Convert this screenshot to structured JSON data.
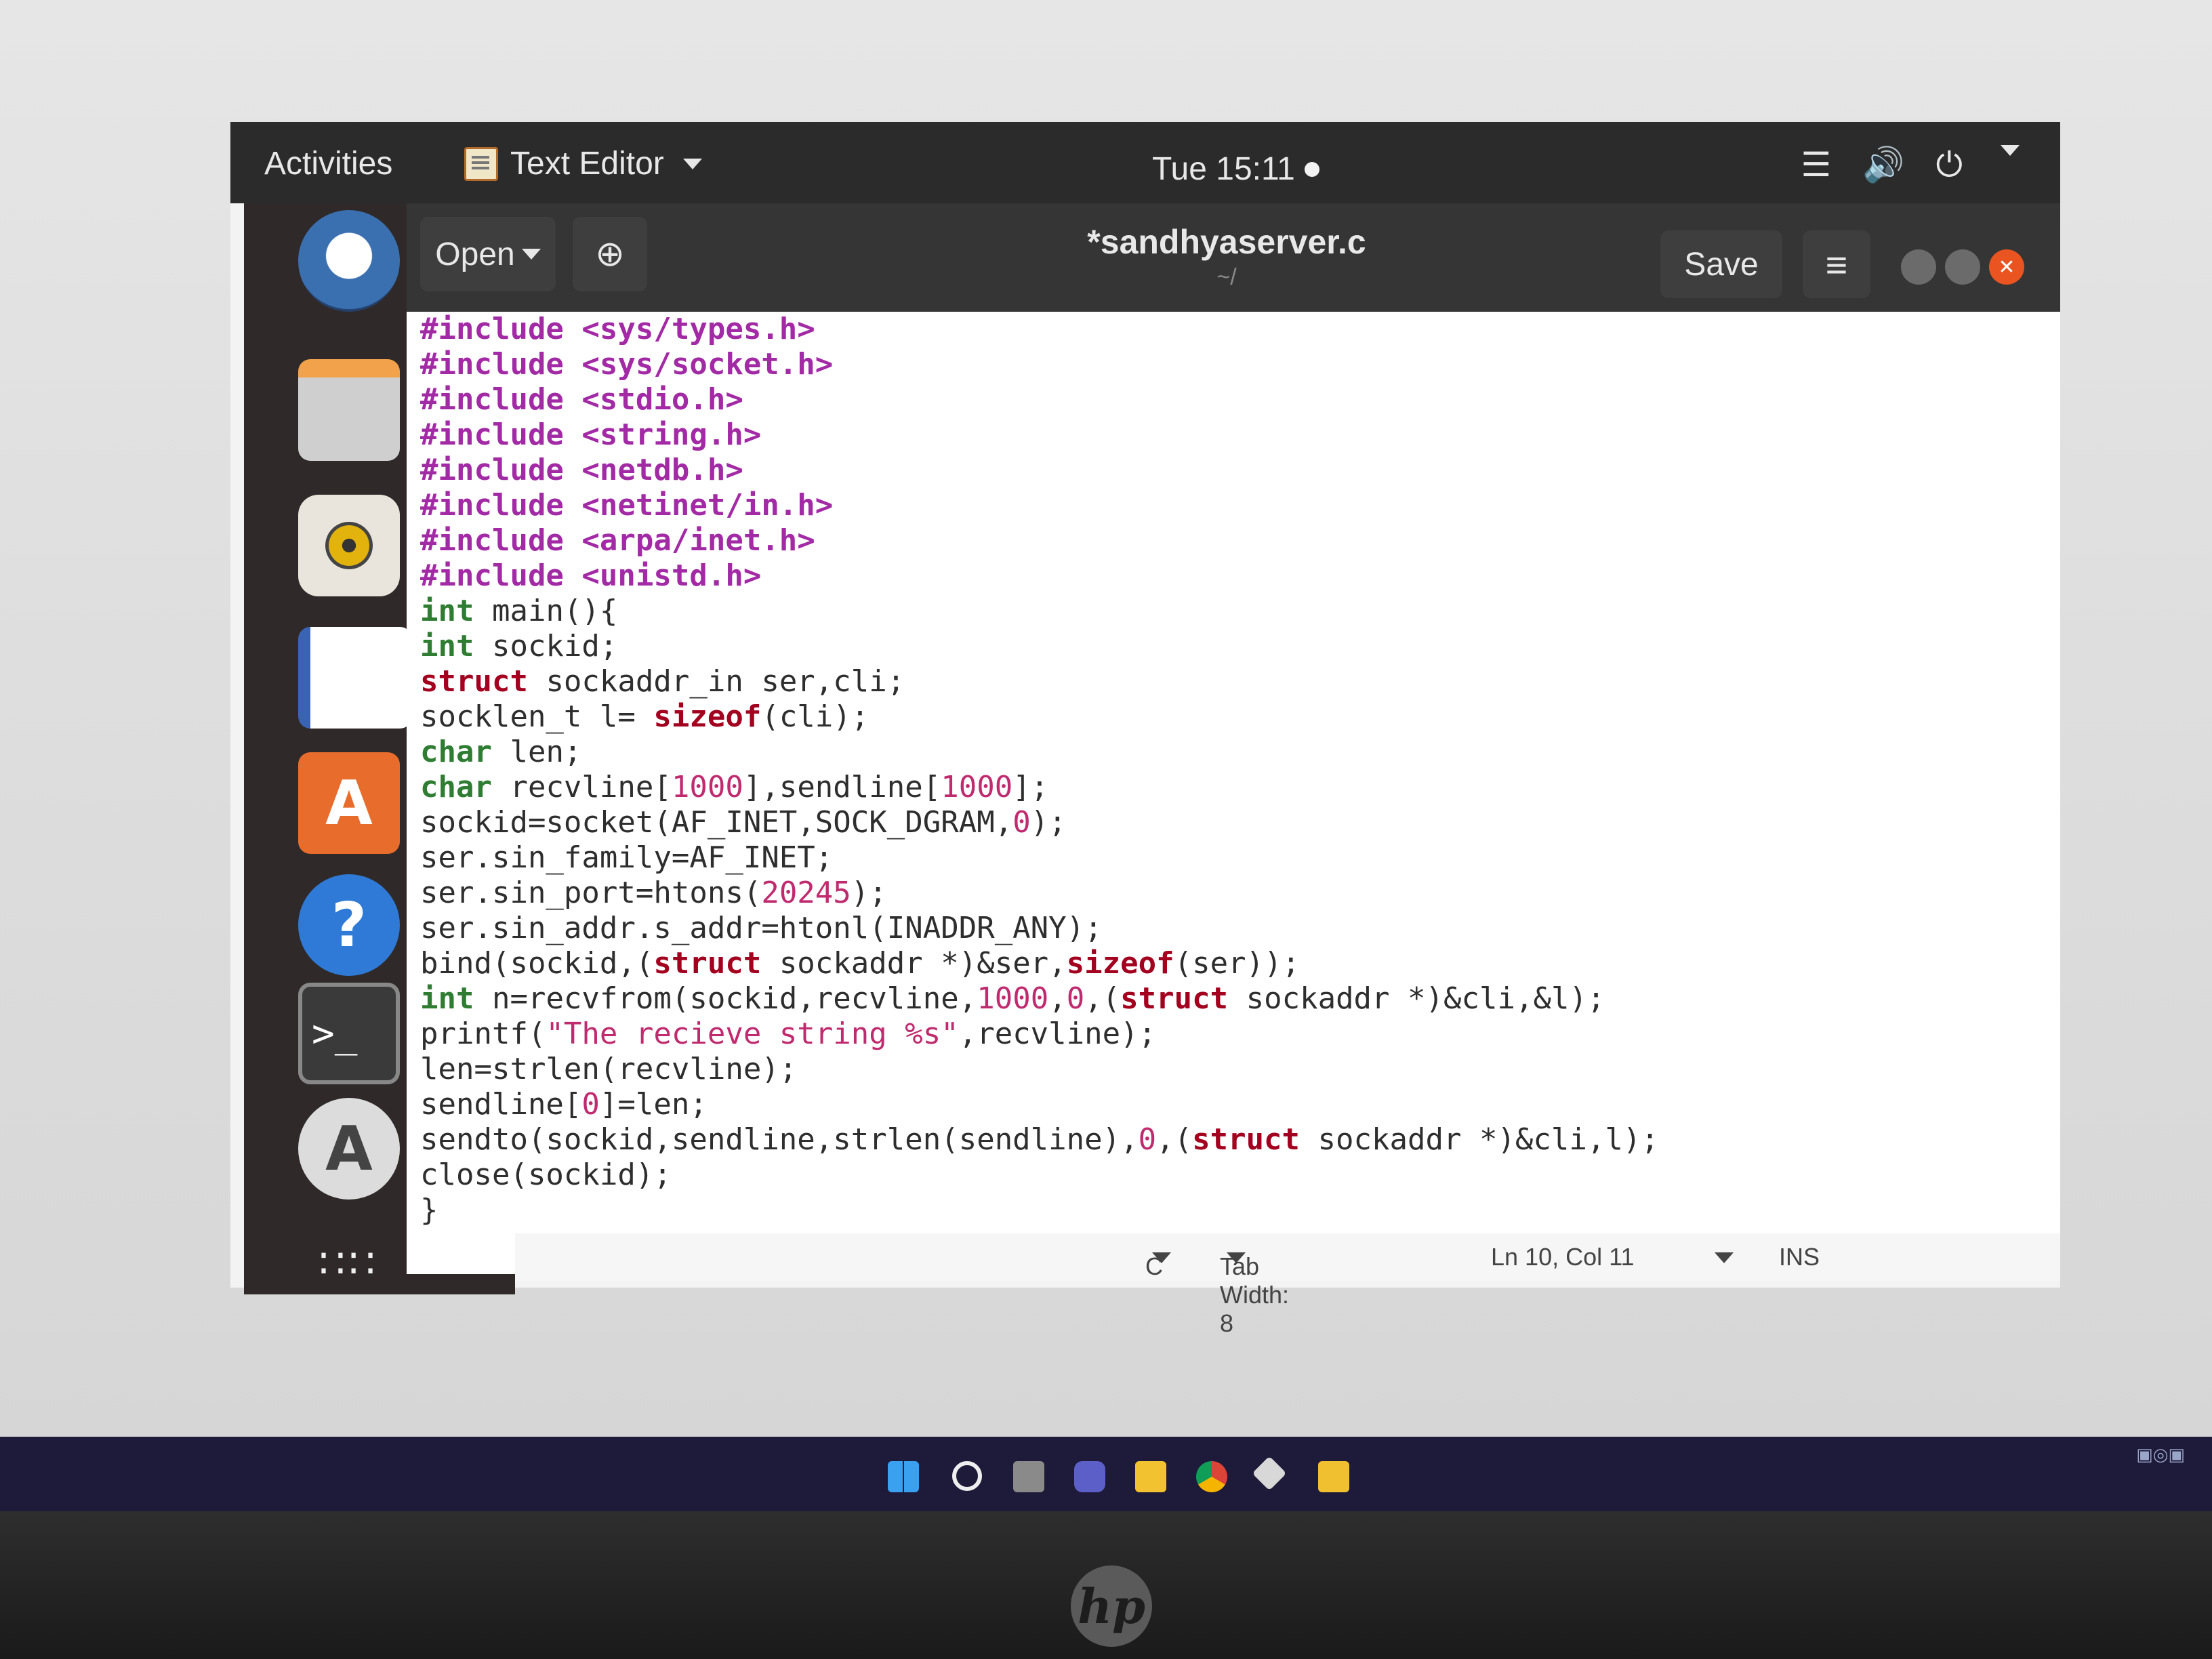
{
  "topbar": {
    "activities": "Activities",
    "app_name": "Text Editor",
    "clock": "Tue 15:11"
  },
  "headerbar": {
    "open_label": "Open",
    "title": "*sandhyaserver.c",
    "subtitle": "~/",
    "save_label": "Save"
  },
  "code": {
    "lines": [
      [
        [
          "pre",
          "#include <sys/types.h>"
        ]
      ],
      [
        [
          "pre",
          "#include <sys/socket.h>"
        ]
      ],
      [
        [
          "pre",
          "#include <stdio.h>"
        ]
      ],
      [
        [
          "pre",
          "#include <string.h>"
        ]
      ],
      [
        [
          "pre",
          "#include <netdb.h>"
        ]
      ],
      [
        [
          "pre",
          "#include <netinet/in.h>"
        ]
      ],
      [
        [
          "pre",
          "#include <arpa/inet.h>"
        ]
      ],
      [
        [
          "pre",
          "#include <unistd.h>"
        ]
      ],
      [
        [
          "kw",
          "int"
        ],
        [
          "plain",
          " main(){"
        ]
      ],
      [
        [
          "kw",
          "int"
        ],
        [
          "plain",
          " sockid;"
        ]
      ],
      [
        [
          "kw2",
          "struct"
        ],
        [
          "plain",
          " sockaddr_in ser,cli;"
        ]
      ],
      [
        [
          "plain",
          "socklen_t l= "
        ],
        [
          "kw2",
          "sizeof"
        ],
        [
          "plain",
          "(cli);"
        ]
      ],
      [
        [
          "kw",
          "char"
        ],
        [
          "plain",
          " len;"
        ]
      ],
      [
        [
          "kw",
          "char"
        ],
        [
          "plain",
          " recvline["
        ],
        [
          "num",
          "1000"
        ],
        [
          "plain",
          "],sendline["
        ],
        [
          "num",
          "1000"
        ],
        [
          "plain",
          "];"
        ]
      ],
      [
        [
          "plain",
          "sockid=socket(AF_INET,SOCK_DGRAM,"
        ],
        [
          "num",
          "0"
        ],
        [
          "plain",
          ");"
        ]
      ],
      [
        [
          "plain",
          "ser.sin_family=AF_INET;"
        ]
      ],
      [
        [
          "plain",
          "ser.sin_port=htons("
        ],
        [
          "num",
          "20245"
        ],
        [
          "plain",
          ");"
        ]
      ],
      [
        [
          "plain",
          "ser.sin_addr.s_addr=htonl(INADDR_ANY);"
        ]
      ],
      [
        [
          "plain",
          "bind(sockid,("
        ],
        [
          "kw2",
          "struct"
        ],
        [
          "plain",
          " sockaddr *)&ser,"
        ],
        [
          "kw2",
          "sizeof"
        ],
        [
          "plain",
          "(ser));"
        ]
      ],
      [
        [
          "kw",
          "int"
        ],
        [
          "plain",
          " n=recvfrom(sockid,recvline,"
        ],
        [
          "num",
          "1000"
        ],
        [
          "plain",
          ","
        ],
        [
          "num",
          "0"
        ],
        [
          "plain",
          ",("
        ],
        [
          "kw2",
          "struct"
        ],
        [
          "plain",
          " sockaddr *)&cli,&l);"
        ]
      ],
      [
        [
          "plain",
          "printf("
        ],
        [
          "str",
          "\"The recieve string %s\""
        ],
        [
          "plain",
          ",recvline);"
        ]
      ],
      [
        [
          "plain",
          "len=strlen(recvline);"
        ]
      ],
      [
        [
          "plain",
          "sendline["
        ],
        [
          "num",
          "0"
        ],
        [
          "plain",
          "]=len;"
        ]
      ],
      [
        [
          "plain",
          "sendto(sockid,sendline,strlen(sendline),"
        ],
        [
          "num",
          "0"
        ],
        [
          "plain",
          ",("
        ],
        [
          "kw2",
          "struct"
        ],
        [
          "plain",
          " sockaddr *)&cli,l);"
        ]
      ],
      [
        [
          "plain",
          "close(sockid);"
        ]
      ],
      [
        [
          "plain",
          "}"
        ]
      ]
    ]
  },
  "statusbar": {
    "language": "C",
    "tab_width": "Tab Width: 8",
    "position": "Ln 10, Col 11",
    "mode": "INS"
  },
  "colors": {
    "preprocessor": "#a22aa5",
    "type_keyword": "#2e7d32",
    "keyword": "#a3001f",
    "number": "#c02a6e",
    "close_button": "#e95420"
  },
  "icons": {
    "dock": [
      "thunderbird-icon",
      "files-icon",
      "rhythmbox-icon",
      "writer-icon",
      "software-center-icon",
      "help-icon",
      "terminal-icon",
      "software-updater-icon",
      "show-apps-icon"
    ],
    "taskbar": [
      "windows-start-icon",
      "search-icon",
      "task-view-icon",
      "chat-icon",
      "file-explorer-icon",
      "chrome-icon",
      "virtualbox-icon",
      "paint-icon"
    ]
  }
}
